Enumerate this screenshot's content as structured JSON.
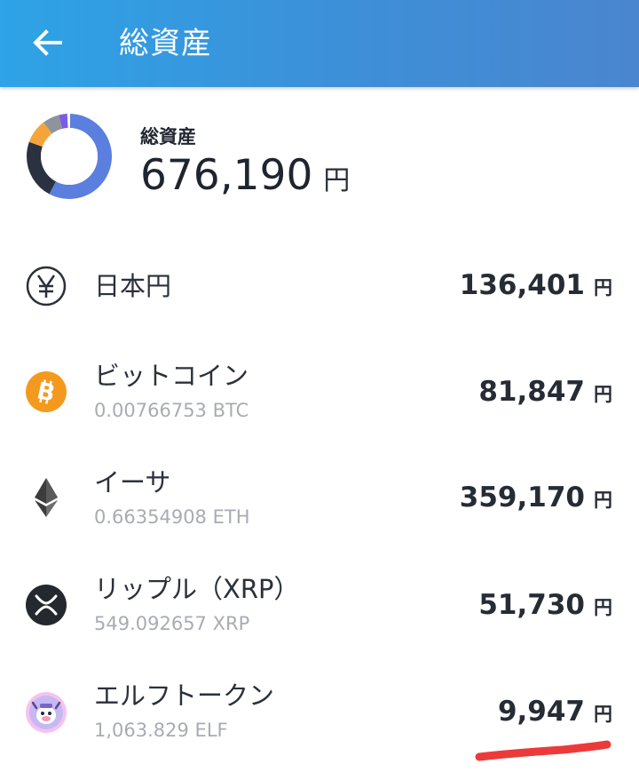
{
  "appbar": {
    "title": "総資産",
    "back_icon": "arrow-left-icon"
  },
  "summary": {
    "label": "総資産",
    "amount": "676,190",
    "unit": "円",
    "donut_colors": {
      "jpy": "#5b7fdf",
      "btc": "#2a3140",
      "eth": "#f5a43a",
      "xrp": "#8e949c",
      "elf": "#7b5ce6"
    }
  },
  "assets": [
    {
      "name": "日本円",
      "quantity": "",
      "value": "136,401",
      "unit": "円",
      "icon": "yen-icon"
    },
    {
      "name": "ビットコイン",
      "quantity": "0.00766753 BTC",
      "value": "81,847",
      "unit": "円",
      "icon": "bitcoin-icon"
    },
    {
      "name": "イーサ",
      "quantity": "0.66354908 ETH",
      "value": "359,170",
      "unit": "円",
      "icon": "ethereum-icon"
    },
    {
      "name": "リップル（XRP）",
      "quantity": "549.092657 XRP",
      "value": "51,730",
      "unit": "円",
      "icon": "xrp-icon"
    },
    {
      "name": "エルフトークン",
      "quantity": "1,063.829 ELF",
      "value": "9,947",
      "unit": "円",
      "icon": "elf-token-icon"
    }
  ],
  "annotation": {
    "underline_color": "#ec3a3a"
  }
}
